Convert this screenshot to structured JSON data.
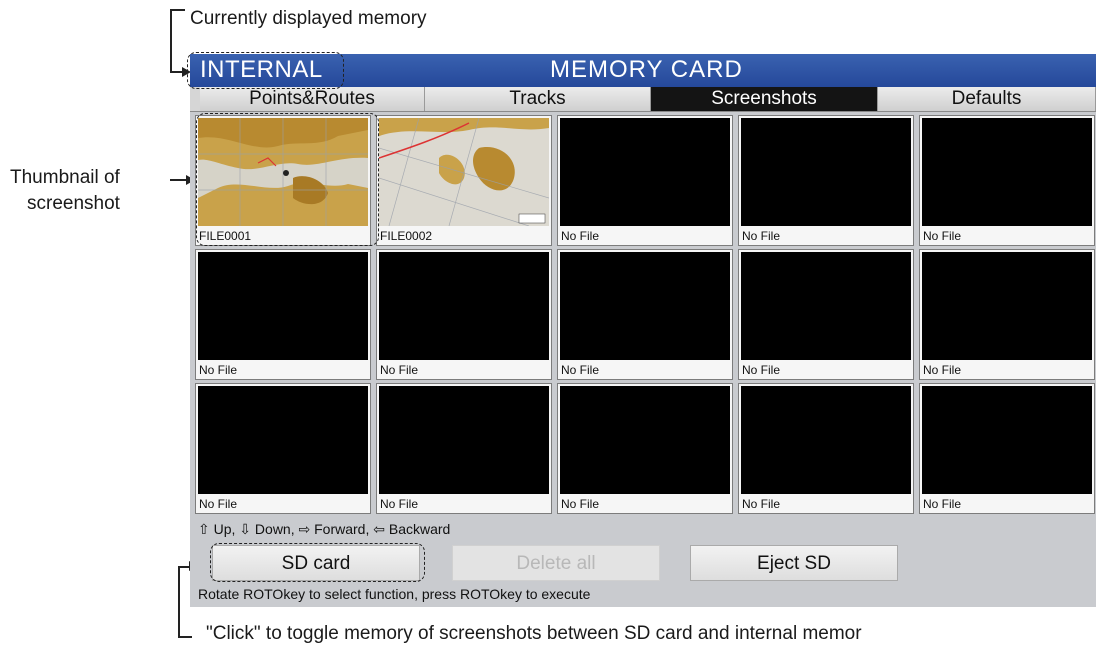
{
  "annotations": {
    "current_memory": "Currently displayed memory",
    "thumbnail_line1": "Thumbnail of",
    "thumbnail_line2": "screenshot",
    "click_note": "\"Click\" to toggle memory of screenshots between SD card and internal memor"
  },
  "screen": {
    "memory_label": "INTERNAL",
    "title": "MEMORY CARD",
    "tabs": [
      {
        "label": "Points&Routes",
        "active": false
      },
      {
        "label": "Tracks",
        "active": false
      },
      {
        "label": "Screenshots",
        "active": true
      },
      {
        "label": "Defaults",
        "active": false
      }
    ],
    "files": [
      "FILE0001",
      "FILE0002",
      "No File",
      "No File",
      "No File",
      "No File",
      "No File",
      "No File",
      "No File",
      "No File",
      "No File",
      "No File",
      "No File",
      "No File",
      "No File"
    ],
    "nav_hint": "⇧ Up, ⇩ Down, ⇨ Forward, ⇦ Backward",
    "buttons": {
      "sd_card": "SD card",
      "delete_all": "Delete all",
      "eject_sd": "Eject SD"
    },
    "footer_hint": "Rotate ROTOkey to select function, press ROTOkey to execute"
  },
  "colors": {
    "titlebar": "#2a4f9f",
    "active_tab": "#141414",
    "panel": "#c9cbcf"
  }
}
